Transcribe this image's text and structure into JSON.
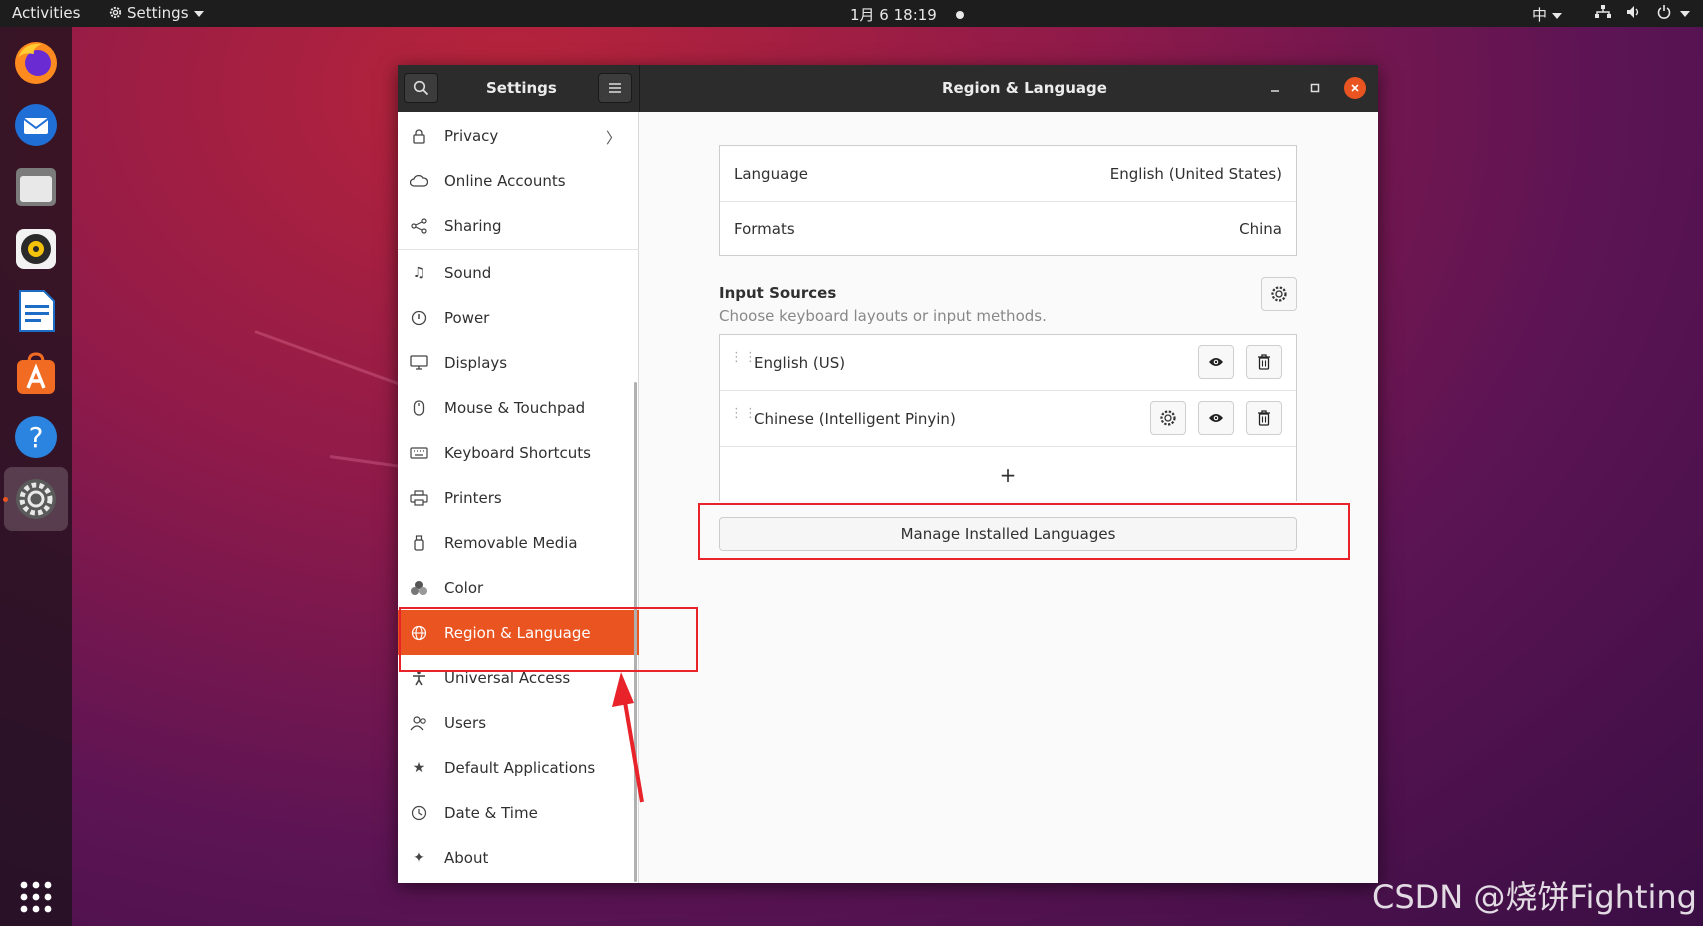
{
  "topbar": {
    "activities": "Activities",
    "app_menu": "Settings",
    "clock": "1月 6  18:19",
    "input_method": "中"
  },
  "dock": {
    "items": [
      "firefox-icon",
      "thunderbird-icon",
      "files-icon",
      "rhythmbox-icon",
      "libreoffice-writer-icon",
      "ubuntu-software-icon",
      "help-icon",
      "settings-icon"
    ],
    "apps_grid": "show-applications-icon"
  },
  "window": {
    "sidebar_title": "Settings",
    "panel_title": "Region & Language"
  },
  "sidebar": {
    "items": [
      {
        "label": "Privacy",
        "icon": "lock-icon"
      },
      {
        "label": "Online Accounts",
        "icon": "cloud-icon"
      },
      {
        "label": "Sharing",
        "icon": "share-icon"
      },
      {
        "label": "Sound",
        "icon": "music-note-icon"
      },
      {
        "label": "Power",
        "icon": "power-icon"
      },
      {
        "label": "Displays",
        "icon": "display-icon"
      },
      {
        "label": "Mouse & Touchpad",
        "icon": "mouse-icon"
      },
      {
        "label": "Keyboard Shortcuts",
        "icon": "keyboard-icon"
      },
      {
        "label": "Printers",
        "icon": "printer-icon"
      },
      {
        "label": "Removable Media",
        "icon": "usb-icon"
      },
      {
        "label": "Color",
        "icon": "color-icon"
      },
      {
        "label": "Region & Language",
        "icon": "globe-icon",
        "selected": true
      },
      {
        "label": "Universal Access",
        "icon": "accessibility-icon"
      },
      {
        "label": "Users",
        "icon": "users-icon"
      },
      {
        "label": "Default Applications",
        "icon": "star-icon"
      },
      {
        "label": "Date & Time",
        "icon": "clock-icon"
      },
      {
        "label": "About",
        "icon": "sparkle-icon"
      }
    ]
  },
  "region": {
    "language_label": "Language",
    "language_value": "English (United States)",
    "formats_label": "Formats",
    "formats_value": "China",
    "input_sources_title": "Input Sources",
    "input_sources_subtitle": "Choose keyboard layouts or input methods.",
    "sources": [
      {
        "name": "English (US)"
      },
      {
        "name": "Chinese (Intelligent Pinyin)"
      }
    ],
    "add_symbol": "+",
    "manage_button": "Manage Installed Languages"
  },
  "colors": {
    "accent": "#e95420",
    "annotation": "#e8232a"
  },
  "watermark": "CSDN @烧饼Fighting"
}
